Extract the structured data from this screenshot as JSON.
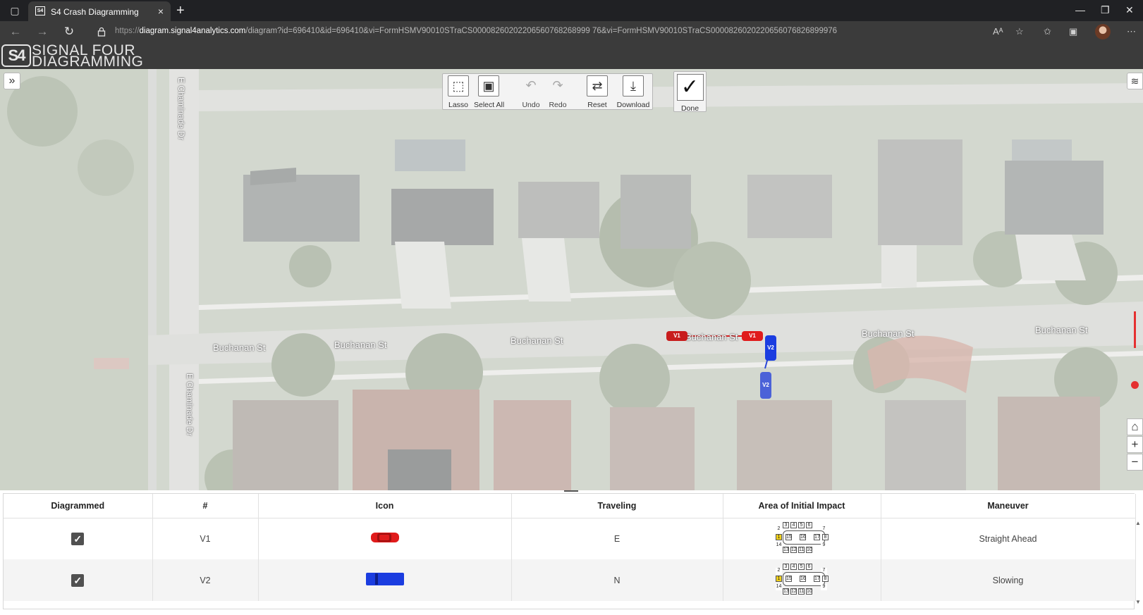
{
  "browser": {
    "tab_title": "S4 Crash Diagramming",
    "url_scheme": "https://",
    "url_host": "diagram.signal4analytics.com",
    "url_path": "/diagram?id=696410&id=696410&vi=FormHSMV90010STraCS00008260202206560768268999 76&vi=FormHSMV90010STraCS0000826020220656076826899976",
    "new_tab_label": "+",
    "close_tab_label": "×"
  },
  "app": {
    "logo_mark": "S4",
    "logo_line1": "SIGNAL FOUR",
    "logo_line2": "DIAGRAMMING"
  },
  "toolbar": {
    "lasso": "Lasso",
    "select_all": "Select All",
    "undo": "Undo",
    "redo": "Redo",
    "reset": "Reset",
    "download": "Download",
    "done": "Done"
  },
  "map": {
    "streets": [
      "Buchanan St",
      "Buchanan St",
      "Buchanan St",
      "Buchanan St",
      "Buchanan St",
      "Buchanan St"
    ],
    "vertical_streets": [
      "E Chaminade Dr",
      "E Chaminade Dr"
    ],
    "vehicle_labels": [
      "V1",
      "V1",
      "V2",
      "V2"
    ]
  },
  "table": {
    "headers": [
      "Diagrammed",
      "#",
      "Icon",
      "Traveling",
      "Area of Initial Impact",
      "Maneuver"
    ],
    "rows": [
      {
        "diagrammed": true,
        "id": "V1",
        "icon_color": "#e01b1b",
        "traveling": "E",
        "maneuver": "Straight Ahead"
      },
      {
        "diagrammed": true,
        "id": "V2",
        "icon_color": "#1b3de0",
        "traveling": "N",
        "maneuver": "Slowing"
      }
    ],
    "impact_numbers": [
      "1",
      "2",
      "3",
      "4",
      "5",
      "6",
      "7",
      "8",
      "9",
      "10",
      "11",
      "12",
      "13",
      "14",
      "15",
      "16",
      "17"
    ]
  }
}
